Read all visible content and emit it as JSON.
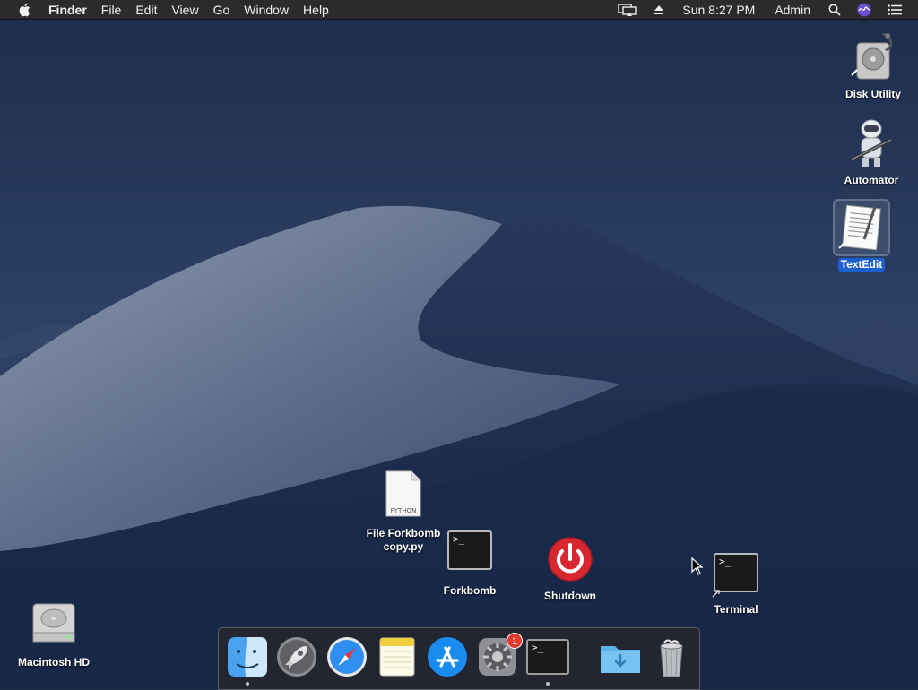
{
  "menubar": {
    "app_name": "Finder",
    "menus": [
      "File",
      "Edit",
      "View",
      "Go",
      "Window",
      "Help"
    ],
    "clock": "Sun 8:27 PM",
    "user": "Admin"
  },
  "desktop": {
    "disk_utility": "Disk Utility",
    "automator": "Automator",
    "textedit": "TextEdit",
    "python_file_line1": "File Forkbomb",
    "python_file_line2": "copy.py",
    "python_badge": "PYTHON",
    "forkbomb": "Forkbomb",
    "shutdown": "Shutdown",
    "terminal": "Terminal",
    "macintosh_hd": "Macintosh HD",
    "terminal_prompt": ">_"
  },
  "dock": {
    "apps": [
      "Finder",
      "Launchpad",
      "Safari",
      "Notes",
      "App Store",
      "System Preferences",
      "Terminal",
      "Downloads",
      "Trash"
    ],
    "system_preferences_badge": "1"
  },
  "colors": {
    "selection": "#1d5fcf",
    "shutdown_red": "#d7282f",
    "menubar": "#2b2b2e"
  }
}
